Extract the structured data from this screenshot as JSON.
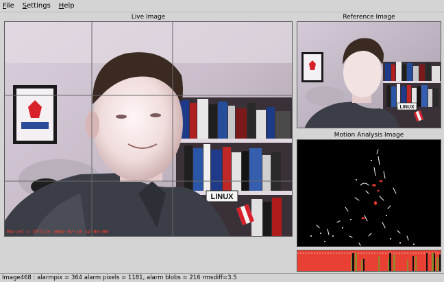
{
  "menubar": {
    "items": [
      {
        "label_ul": "F",
        "label_rest": "ile"
      },
      {
        "label_ul": "S",
        "label_rest": "ettings"
      },
      {
        "label_ul": "H",
        "label_rest": "elp"
      }
    ]
  },
  "panels": {
    "live_title": "Live Image",
    "reference_title": "Reference Image",
    "motion_title": "Motion Analysis Image"
  },
  "live": {
    "overlay": "Marcel's Office 2002-07-10 12:00:00",
    "sign_text": "LINUX"
  },
  "reference": {
    "sign_text": "LINUX"
  },
  "status": {
    "text": "Image468 : alarmpix = 364   alarm pixels = 1181, alarm blobs = 216 rmsdiff=3.5"
  },
  "colors": {
    "alarm_graph": "#e84033",
    "overlay_text": "#ff3b2f"
  }
}
